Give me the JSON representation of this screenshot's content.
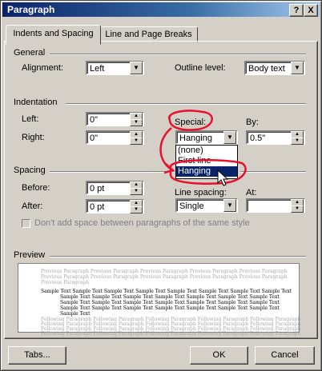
{
  "window": {
    "title": "Paragraph",
    "help_btn": "?",
    "close_btn": "X"
  },
  "tabs": [
    {
      "label": "Indents and Spacing",
      "active": true
    },
    {
      "label": "Line and Page Breaks",
      "active": false
    }
  ],
  "general": {
    "heading": "General",
    "alignment_label": "Alignment:",
    "alignment_value": "Left",
    "outline_label": "Outline level:",
    "outline_value": "Body text"
  },
  "indentation": {
    "heading": "Indentation",
    "left_label": "Left:",
    "left_value": "0\"",
    "right_label": "Right:",
    "right_value": "0\"",
    "special_label": "Special:",
    "special_value": "Hanging",
    "by_label": "By:",
    "by_value": "0.5\"",
    "special_options": [
      "(none)",
      "First line",
      "Hanging"
    ],
    "selected_option": "Hanging"
  },
  "spacing": {
    "heading": "Spacing",
    "before_label": "Before:",
    "before_value": "0 pt",
    "after_label": "After:",
    "after_value": "0 pt",
    "line_spacing_label": "Line spacing:",
    "line_spacing_value": "Single",
    "at_label": "At:",
    "at_value": "",
    "no_space_checkbox": "Don't add space between paragraphs of the same style"
  },
  "preview": {
    "heading": "Preview",
    "prev_lines": [
      "Previous Paragraph Previous Paragraph Previous Paragraph Previous Paragraph Previous Paragraph",
      "Previous Paragraph Previous Paragraph Previous Paragraph Previous Paragraph Previous Paragraph",
      "Previous Paragraph"
    ],
    "sample_lines": [
      "Sample Text Sample Text Sample Text Sample Text Sample Text Sample Text Sample Text Sample Text",
      "Sample Text Sample Text Sample Text Sample Text Sample Text Sample Text Sample Text",
      "Sample Text Sample Text Sample Text Sample Text Sample Text Sample Text Sample Text",
      "Sample Text Sample Text Sample Text Sample Text Sample Text Sample Text Sample Text",
      "Sample Text"
    ],
    "follow_lines": [
      "Following Paragraph Following Paragraph Following Paragraph Following Paragraph Following Paragraph",
      "Following Paragraph Following Paragraph Following Paragraph Following Paragraph Following Paragraph",
      "Following Paragraph Following Paragraph Following Paragraph Following Paragraph Following Paragraph",
      "Following Paragraph Following Paragraph Following Paragraph Following Paragraph Following Paragraph"
    ]
  },
  "buttons": {
    "tabs": "Tabs...",
    "ok": "OK",
    "cancel": "Cancel"
  },
  "colors": {
    "title_bar": "#0a246a",
    "annotation": "#e8112d",
    "selection": "#0a246a"
  }
}
